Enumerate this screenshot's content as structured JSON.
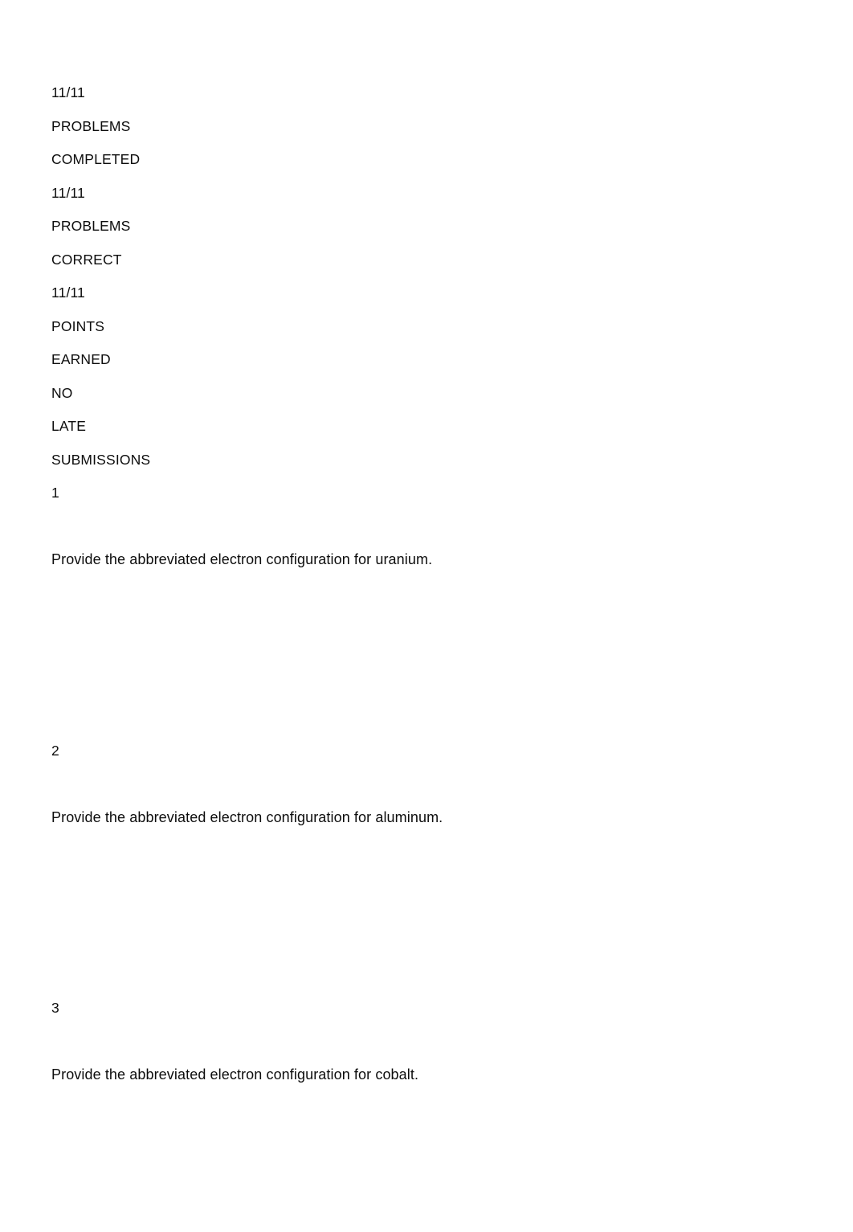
{
  "document": {
    "background_color": "#ffffff",
    "text_color": "#0d0d0d",
    "summary": {
      "lines": [
        "11/11",
        "PROBLEMS",
        "COMPLETED",
        "11/11",
        "PROBLEMS",
        "CORRECT",
        "11/11",
        "POINTS",
        "EARNED",
        "NO",
        "LATE",
        "SUBMISSIONS"
      ]
    },
    "questions": [
      {
        "number": "1",
        "text": "Provide the abbreviated electron configuration for uranium.",
        "answer": ""
      },
      {
        "number": "2",
        "text": "Provide the abbreviated electron configuration for aluminum.",
        "answer": ""
      },
      {
        "number": "3",
        "text": "Provide the abbreviated electron configuration for cobalt.",
        "answer": ""
      }
    ]
  }
}
